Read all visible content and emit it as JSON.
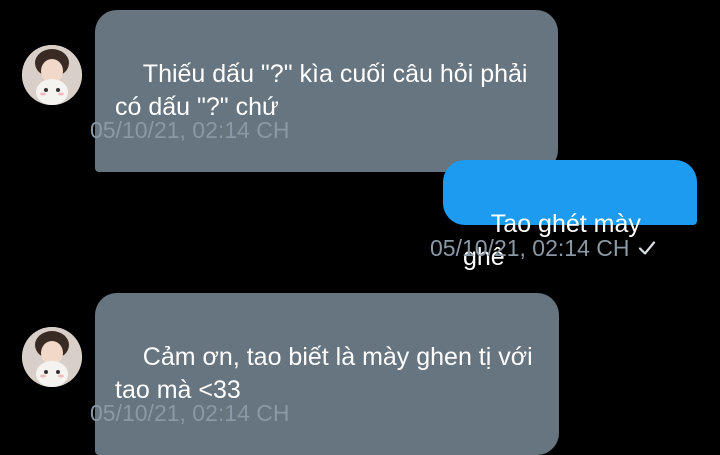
{
  "conversation": {
    "messages": [
      {
        "direction": "incoming",
        "text": "Thiếu dấu \"?\" kìa cuối câu hỏi phải có dấu \"?\" chứ",
        "timestamp": "05/10/21, 02:14 CH"
      },
      {
        "direction": "outgoing",
        "text": "Tao ghét mày ghê",
        "timestamp": "05/10/21, 02:14 CH",
        "status_icon": "check-icon"
      },
      {
        "direction": "incoming",
        "text": "Cảm ơn, tao biết là mày ghen tị với tao mà <33",
        "timestamp": "05/10/21, 02:14 CH"
      }
    ]
  },
  "colors": {
    "background": "#000000",
    "incoming_bubble": "#66757f",
    "outgoing_bubble": "#1d9bf0",
    "timestamp": "#8b98a5"
  },
  "icons": {
    "avatar": "avatar-icon",
    "read_receipt": "check-icon"
  }
}
